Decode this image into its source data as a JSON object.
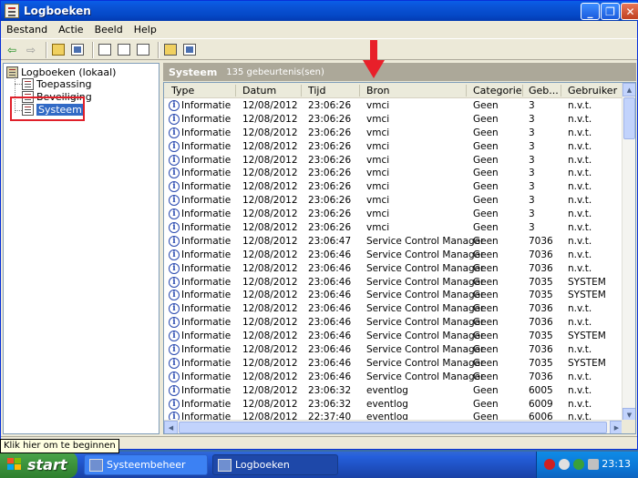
{
  "window": {
    "title": "Logboeken",
    "controls": {
      "minimize": "_",
      "maximize": "❐",
      "close": "✕"
    }
  },
  "menu": [
    "Bestand",
    "Actie",
    "Beeld",
    "Help"
  ],
  "tree": {
    "root": "Logboeken (lokaal)",
    "items": [
      "Toepassing",
      "Beveiliging",
      "Systeem"
    ],
    "selected": "Systeem"
  },
  "panel": {
    "title": "Systeem",
    "count": "135 gebeurtenis(sen)"
  },
  "columns": [
    "Type",
    "Datum",
    "Tijd",
    "Bron",
    "Categorie",
    "Geb...",
    "Gebruiker"
  ],
  "rows": [
    [
      "Informatie",
      "12/08/2012",
      "23:06:26",
      "vmci",
      "Geen",
      "3",
      "n.v.t."
    ],
    [
      "Informatie",
      "12/08/2012",
      "23:06:26",
      "vmci",
      "Geen",
      "3",
      "n.v.t."
    ],
    [
      "Informatie",
      "12/08/2012",
      "23:06:26",
      "vmci",
      "Geen",
      "3",
      "n.v.t."
    ],
    [
      "Informatie",
      "12/08/2012",
      "23:06:26",
      "vmci",
      "Geen",
      "3",
      "n.v.t."
    ],
    [
      "Informatie",
      "12/08/2012",
      "23:06:26",
      "vmci",
      "Geen",
      "3",
      "n.v.t."
    ],
    [
      "Informatie",
      "12/08/2012",
      "23:06:26",
      "vmci",
      "Geen",
      "3",
      "n.v.t."
    ],
    [
      "Informatie",
      "12/08/2012",
      "23:06:26",
      "vmci",
      "Geen",
      "3",
      "n.v.t."
    ],
    [
      "Informatie",
      "12/08/2012",
      "23:06:26",
      "vmci",
      "Geen",
      "3",
      "n.v.t."
    ],
    [
      "Informatie",
      "12/08/2012",
      "23:06:26",
      "vmci",
      "Geen",
      "3",
      "n.v.t."
    ],
    [
      "Informatie",
      "12/08/2012",
      "23:06:26",
      "vmci",
      "Geen",
      "3",
      "n.v.t."
    ],
    [
      "Informatie",
      "12/08/2012",
      "23:06:47",
      "Service Control Manager",
      "Geen",
      "7036",
      "n.v.t."
    ],
    [
      "Informatie",
      "12/08/2012",
      "23:06:46",
      "Service Control Manager",
      "Geen",
      "7036",
      "n.v.t."
    ],
    [
      "Informatie",
      "12/08/2012",
      "23:06:46",
      "Service Control Manager",
      "Geen",
      "7036",
      "n.v.t."
    ],
    [
      "Informatie",
      "12/08/2012",
      "23:06:46",
      "Service Control Manager",
      "Geen",
      "7035",
      "SYSTEM"
    ],
    [
      "Informatie",
      "12/08/2012",
      "23:06:46",
      "Service Control Manager",
      "Geen",
      "7035",
      "SYSTEM"
    ],
    [
      "Informatie",
      "12/08/2012",
      "23:06:46",
      "Service Control Manager",
      "Geen",
      "7036",
      "n.v.t."
    ],
    [
      "Informatie",
      "12/08/2012",
      "23:06:46",
      "Service Control Manager",
      "Geen",
      "7036",
      "n.v.t."
    ],
    [
      "Informatie",
      "12/08/2012",
      "23:06:46",
      "Service Control Manager",
      "Geen",
      "7035",
      "SYSTEM"
    ],
    [
      "Informatie",
      "12/08/2012",
      "23:06:46",
      "Service Control Manager",
      "Geen",
      "7036",
      "n.v.t."
    ],
    [
      "Informatie",
      "12/08/2012",
      "23:06:46",
      "Service Control Manager",
      "Geen",
      "7035",
      "SYSTEM"
    ],
    [
      "Informatie",
      "12/08/2012",
      "23:06:46",
      "Service Control Manager",
      "Geen",
      "7036",
      "n.v.t."
    ],
    [
      "Informatie",
      "12/08/2012",
      "23:06:32",
      "eventlog",
      "Geen",
      "6005",
      "n.v.t."
    ],
    [
      "Informatie",
      "12/08/2012",
      "23:06:32",
      "eventlog",
      "Geen",
      "6009",
      "n.v.t."
    ],
    [
      "Informatie",
      "12/08/2012",
      "22:37:40",
      "eventlog",
      "Geen",
      "6006",
      "n.v.t."
    ]
  ],
  "tooltip": "Klik hier om te beginnen",
  "taskbar": {
    "start": "start",
    "tasks": [
      "Systeembeheer",
      "Logboeken"
    ],
    "clock": "23:13"
  },
  "colors": {
    "title_bar": "#0a5ee8",
    "selection": "#316ac5",
    "annotation": "#e0202a",
    "start_green": "#3c923c"
  }
}
